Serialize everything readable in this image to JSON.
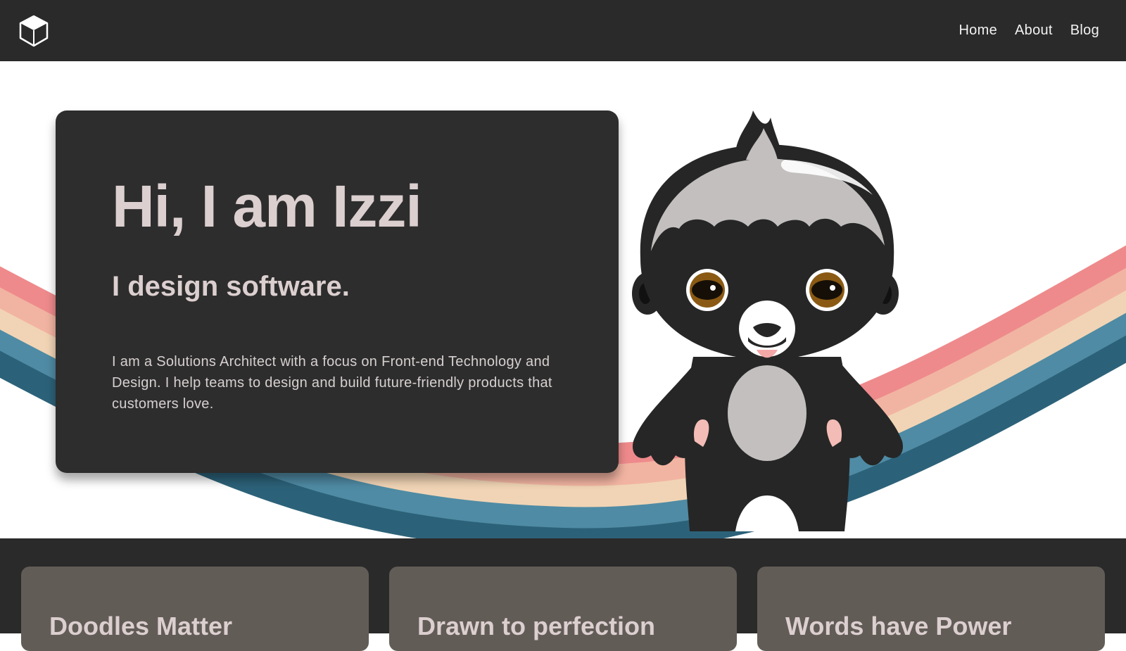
{
  "nav": {
    "links": [
      {
        "label": "Home"
      },
      {
        "label": "About"
      },
      {
        "label": "Blog"
      }
    ]
  },
  "hero": {
    "title": "Hi, I am Izzi",
    "subtitle": "I design software.",
    "description": "I am a Solutions Architect with a focus on Front-end Technology and Design. I help teams to design and build future-friendly products that customers love."
  },
  "cards": [
    {
      "title": "Doodles Matter"
    },
    {
      "title": "Drawn to perfection"
    },
    {
      "title": "Words have Power"
    }
  ],
  "colors": {
    "nav_bg": "#2a2a2a",
    "card_bg": "#2d2d2d",
    "heading_text": "#dccfcf",
    "feature_card_bg": "#625c57",
    "rainbow": [
      "#ee8a8c",
      "#f2b4a2",
      "#f1d4b5",
      "#4f8ba4",
      "#2c6279"
    ]
  },
  "icons": {
    "logo": "cube-heart-logo-icon",
    "mascot": "honey-badger-mascot"
  }
}
